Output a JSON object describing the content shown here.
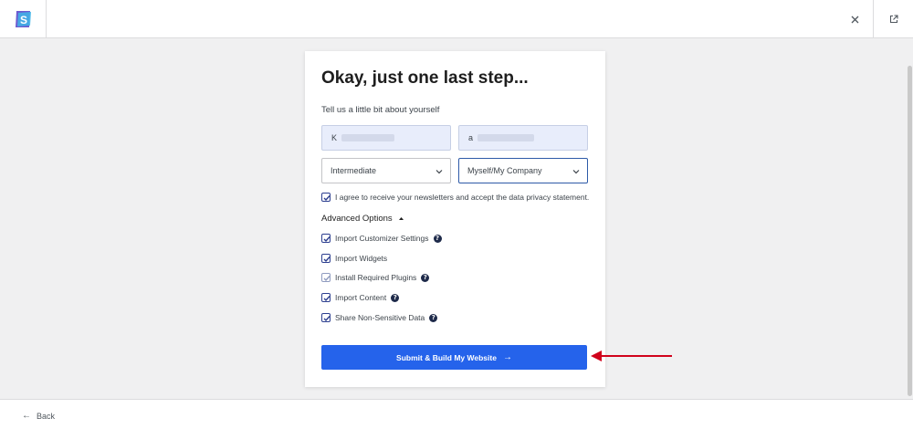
{
  "header": {
    "logo_icon": "brand-s-logo-icon",
    "close_icon": "close-icon",
    "external_icon": "external-link-icon"
  },
  "card": {
    "title": "Okay, just one last step...",
    "subtitle": "Tell us a little bit about yourself",
    "first_name_value": "K",
    "email_value": "a",
    "level_select": "Intermediate",
    "usage_select": "Myself/My Company",
    "newsletter_label": "I agree to receive your newsletters and accept the data privacy statement.",
    "advanced_label": "Advanced Options",
    "options": [
      {
        "label": "Import Customizer Settings",
        "checked": true,
        "help": true
      },
      {
        "label": "Import Widgets",
        "checked": true,
        "help": false
      },
      {
        "label": "Install Required Plugins",
        "checked": true,
        "help": true
      },
      {
        "label": "Import Content",
        "checked": true,
        "help": true
      },
      {
        "label": "Share Non-Sensitive Data",
        "checked": true,
        "help": true
      }
    ],
    "submit_label": "Submit & Build My Website",
    "submit_arrow": "→"
  },
  "footer": {
    "back_arrow": "←",
    "back_label": "Back"
  },
  "colors": {
    "accent": "#2563eb",
    "annotation": "#d0021b",
    "input_bg": "#e8edfb"
  }
}
